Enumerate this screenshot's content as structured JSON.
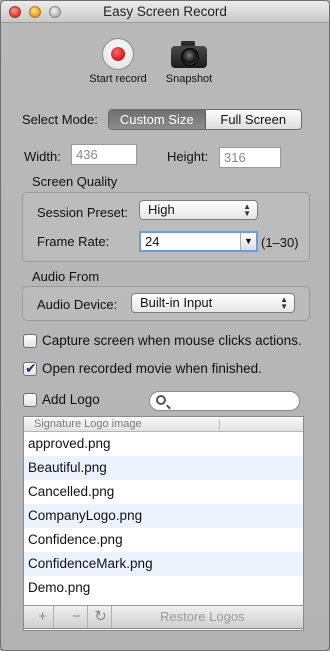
{
  "window": {
    "title": "Easy Screen Record"
  },
  "toolbar": {
    "start_record": "Start record",
    "snapshot": "Snapshot"
  },
  "mode": {
    "label": "Select Mode:",
    "options": [
      "Custom Size",
      "Full Screen"
    ],
    "selected": "Custom Size"
  },
  "size": {
    "width_label": "Width:",
    "width_value": "436",
    "height_label": "Height:",
    "height_value": "316"
  },
  "quality": {
    "title": "Screen  Quality",
    "preset_label": "Session Preset:",
    "preset_value": "High",
    "frame_label": "Frame Rate:",
    "frame_value": "24",
    "frame_range": "(1–30)"
  },
  "audio": {
    "title": "Audio From",
    "device_label": "Audio Device:",
    "device_value": "Built-in Input"
  },
  "options": {
    "capture_clicks": {
      "label": "Capture screen when mouse clicks actions.",
      "checked": false
    },
    "open_movie": {
      "label": "Open recorded movie when finished.",
      "checked": true
    }
  },
  "logo": {
    "add_label": "Add Logo",
    "checked": false,
    "search_placeholder": "",
    "column_header": "Signature Logo image",
    "items": [
      "approved.png",
      "Beautiful.png",
      "Cancelled.png",
      "CompanyLogo.png",
      "Confidence.png",
      "ConfidenceMark.png",
      "Demo.png"
    ],
    "add_button": "+",
    "remove_button": "−",
    "refresh_icon": "↻",
    "restore_label": "Restore Logos"
  }
}
